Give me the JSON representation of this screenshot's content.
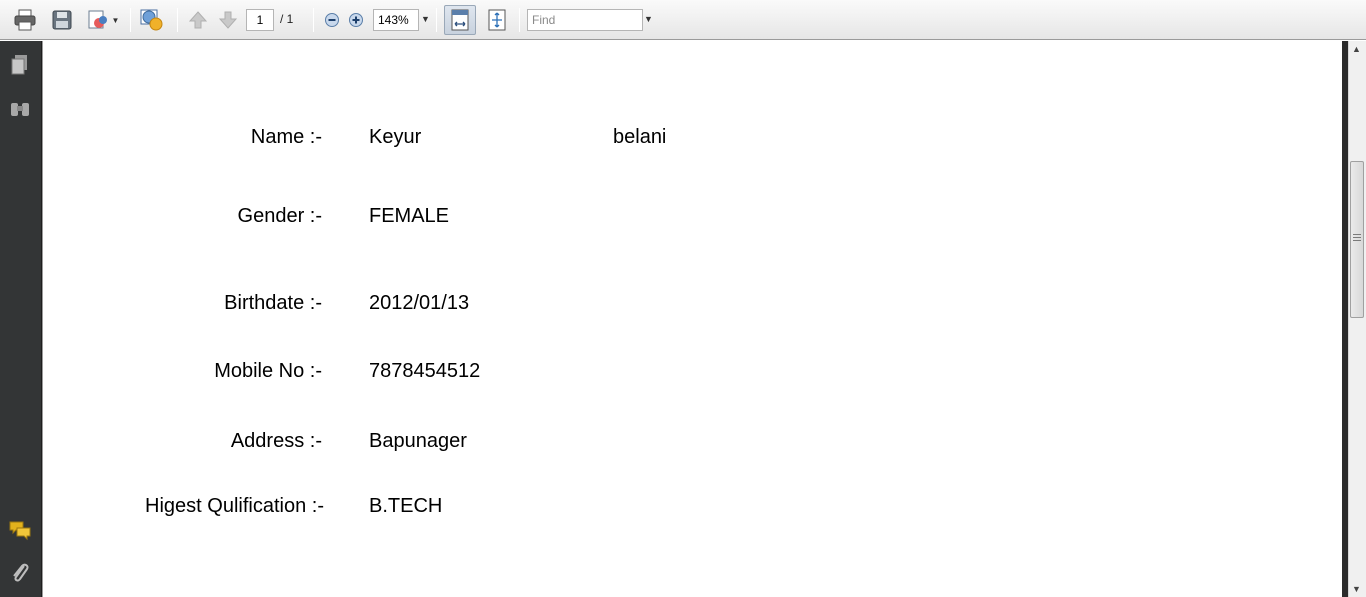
{
  "toolbar": {
    "page_current": "1",
    "page_total": "/ 1",
    "zoom": "143%",
    "find_placeholder": "Find",
    "icons": [
      "print-icon",
      "save-icon",
      "share-icon",
      "collaborate-icon",
      "previous-page-icon",
      "next-page-icon",
      "zoom-out-icon",
      "zoom-in-icon",
      "fit-width-icon",
      "fit-page-icon"
    ]
  },
  "navpane": {
    "icons": [
      "pages-icon",
      "attachments-binoculars-icon",
      "comments-icon",
      "paperclip-icon"
    ]
  },
  "document": {
    "fields": [
      {
        "label": "Name :-",
        "value": "Keyur",
        "value2": "belani"
      },
      {
        "label": "Gender :-",
        "value": "FEMALE"
      },
      {
        "label": "Birthdate :-",
        "value": "2012/01/13"
      },
      {
        "label": "Mobile No :-",
        "value": "7878454512"
      },
      {
        "label": "Address :-",
        "value": "Bapunager"
      },
      {
        "label": "Higest Qulification :-",
        "value": "B.TECH"
      }
    ]
  },
  "colors": {
    "navpane": "#333536",
    "toolbar": "#eeeeee",
    "accent_yellow": "#e2b21c"
  }
}
